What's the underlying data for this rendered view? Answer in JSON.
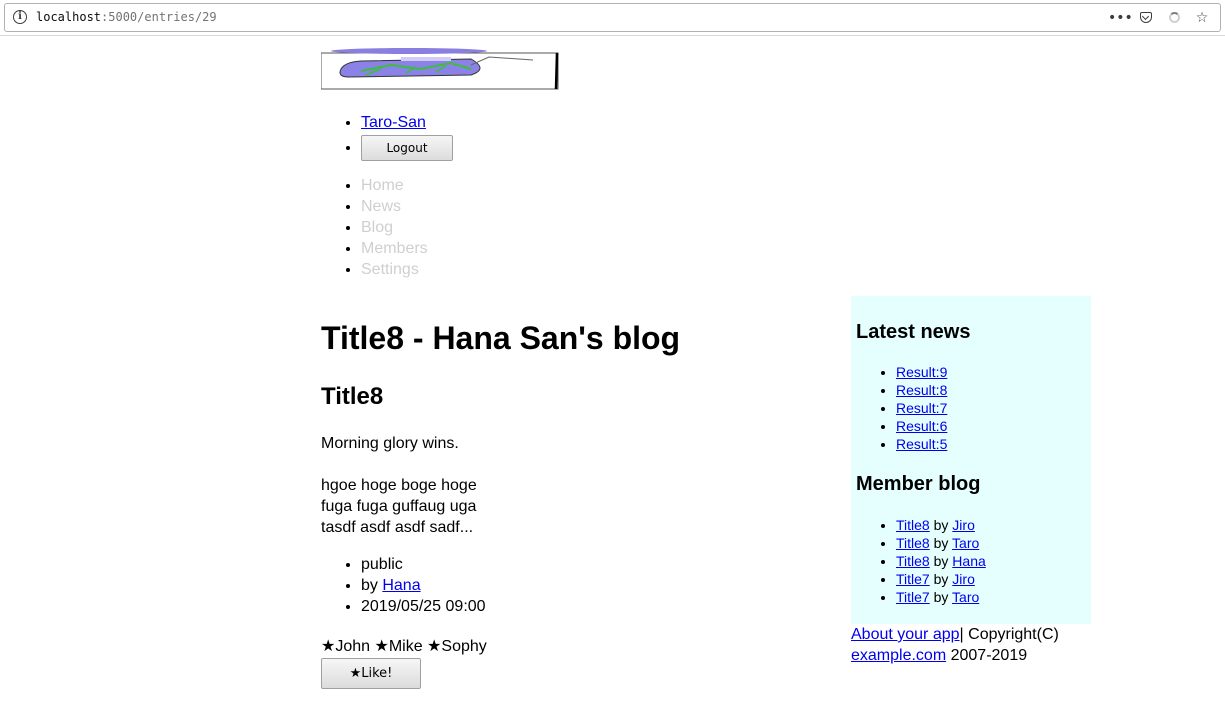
{
  "browser": {
    "url_host": "localhost",
    "url_path": ":5000/entries/29",
    "menu_icon": "ellipsis-icon",
    "pocket_icon": "pocket-icon",
    "loading_icon": "spinner-icon",
    "bookmark_icon": "star-outline-icon"
  },
  "user_menu": {
    "username": "Taro-San",
    "logout_label": "Logout"
  },
  "nav": {
    "items": [
      "Home",
      "News",
      "Blog",
      "Members",
      "Settings"
    ]
  },
  "entry": {
    "page_title": "Title8 - Hana San's blog",
    "title": "Title8",
    "summary": "Morning glory wins.",
    "body_lines": [
      "hgoe hoge boge hoge",
      "fuga fuga guffaug uga",
      "tasdf asdf asdf sadf..."
    ],
    "visibility": "public",
    "by_label": "by ",
    "author": "Hana",
    "date": "2019/05/25 09:00",
    "likers": "★John ★Mike ★Sophy",
    "like_label": "★Like!"
  },
  "sidebar": {
    "news_heading": "Latest news",
    "news_items": [
      "Result:9",
      "Result:8",
      "Result:7",
      "Result:6",
      "Result:5"
    ],
    "blog_heading": "Member blog",
    "blog_items": [
      {
        "title": "Title8",
        "by": " by ",
        "author": "Jiro"
      },
      {
        "title": "Title8",
        "by": " by ",
        "author": "Taro"
      },
      {
        "title": "Title8",
        "by": " by ",
        "author": "Hana"
      },
      {
        "title": "Title7",
        "by": " by ",
        "author": "Jiro"
      },
      {
        "title": "Title7",
        "by": " by ",
        "author": "Taro"
      }
    ]
  },
  "footer": {
    "about_link": "About your app",
    "copyright": "| Copyright(C)",
    "site_link": "example.com",
    "years": " 2007-2019"
  },
  "colors": {
    "sidebar_bg": "#e5ffff",
    "link": "#0000ee",
    "nav_disabled": "#cfcfcf"
  }
}
